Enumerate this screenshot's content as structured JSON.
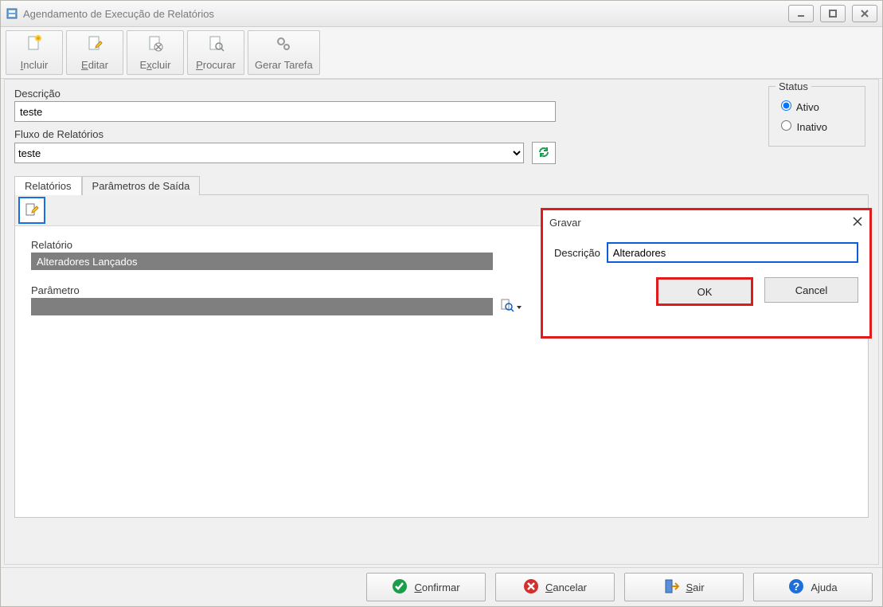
{
  "window": {
    "title": "Agendamento de Execução de Relatórios"
  },
  "toolbar": {
    "incluir": "Incluir",
    "editar": "Editar",
    "excluir": "Excluir",
    "procurar": "Procurar",
    "gerar_tarefa": "Gerar Tarefa"
  },
  "form": {
    "descricao_label": "Descrição",
    "descricao_value": "teste",
    "fluxo_label": "Fluxo de Relatórios",
    "fluxo_value": "teste"
  },
  "status": {
    "legend": "Status",
    "ativo_label": "Ativo",
    "inativo_label": "Inativo",
    "selected": "ativo"
  },
  "tabs": {
    "relatorios": "Relatórios",
    "param_saida": "Parâmetros de Saída"
  },
  "relatorio": {
    "label": "Relatório",
    "value": "Alteradores Lançados",
    "param_label": "Parâmetro",
    "param_value": ""
  },
  "bottom": {
    "confirmar": "Confirmar",
    "cancelar": "Cancelar",
    "sair": "Sair",
    "ajuda": "Ajuda"
  },
  "modal": {
    "title": "Gravar",
    "descricao_label": "Descrição",
    "descricao_value": "Alteradores",
    "ok": "OK",
    "cancel": "Cancel"
  }
}
